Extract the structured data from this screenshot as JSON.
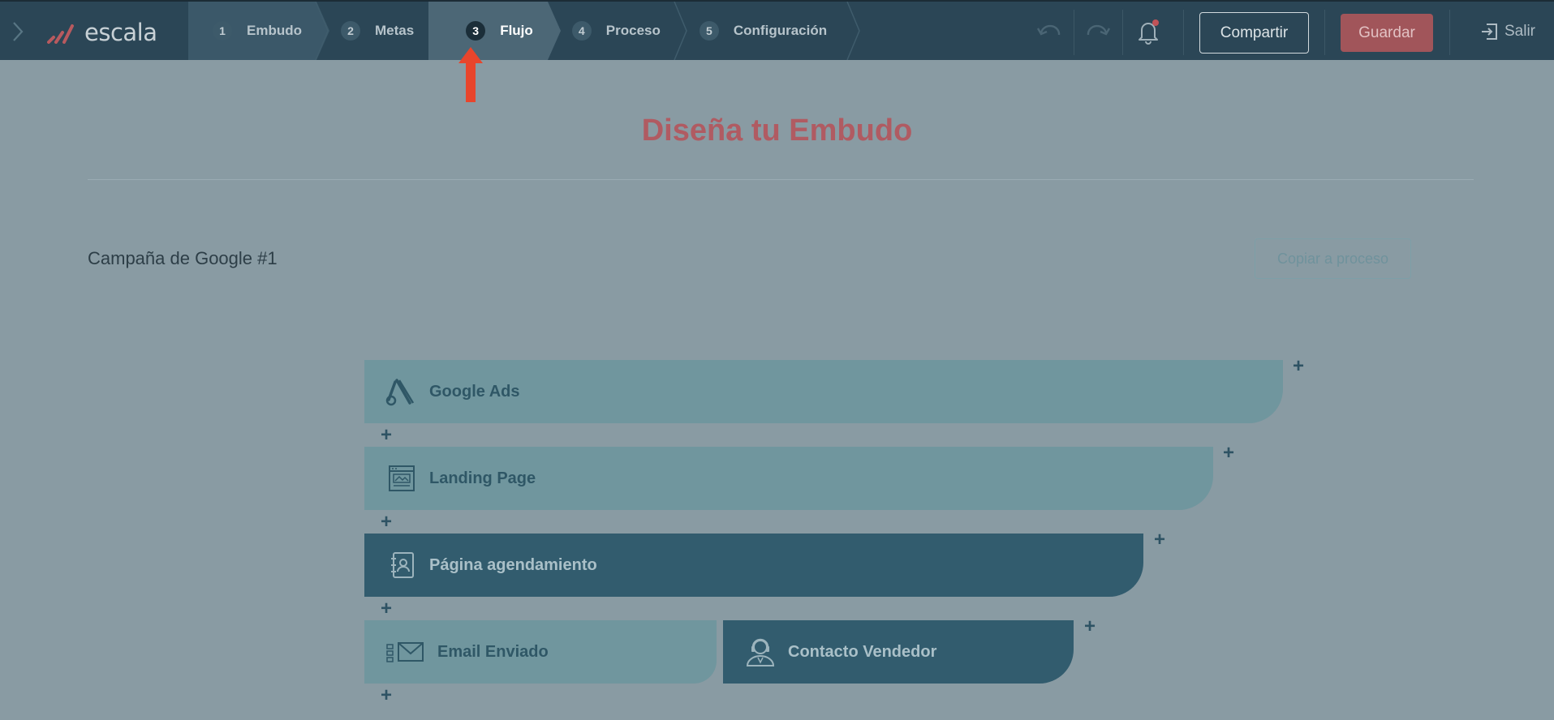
{
  "app": {
    "logo_text": "escala"
  },
  "nav": {
    "steps": [
      {
        "num": "1",
        "label": "Embudo"
      },
      {
        "num": "2",
        "label": "Metas"
      },
      {
        "num": "3",
        "label": "Flujo"
      },
      {
        "num": "4",
        "label": "Proceso"
      },
      {
        "num": "5",
        "label": "Configuración"
      }
    ],
    "active_step": "3"
  },
  "toolbar": {
    "share_label": "Compartir",
    "save_label": "Guardar",
    "exit_label": "Salir"
  },
  "icons": {
    "menu": "chevron-right-icon",
    "undo": "undo-icon",
    "redo": "redo-icon",
    "notifications": "bell-icon",
    "exit": "exit-icon",
    "pointer": "arrow-up-icon"
  },
  "main": {
    "title": "Diseña tu Embudo",
    "campaign_name": "Campaña de Google #1",
    "copy_button": "Copiar a proceso"
  },
  "funnel": {
    "stages": [
      {
        "label": "Google Ads",
        "icon": "google-ads-icon",
        "style": "light"
      },
      {
        "label": "Landing Page",
        "icon": "landing-page-icon",
        "style": "light"
      },
      {
        "label": "Página agendamiento",
        "icon": "scheduling-book-icon",
        "style": "dark"
      },
      {
        "label": "Email Enviado",
        "icon": "email-icon",
        "style": "light"
      },
      {
        "label": "Contacto Vendedor",
        "icon": "salesperson-icon",
        "style": "dark"
      }
    ],
    "add_symbol": "+"
  },
  "colors": {
    "topbar": "#2b4656",
    "background": "#899ba3",
    "title": "#b05b62",
    "save_button": "#a1555a",
    "stage_light": "#70969e",
    "stage_dark": "#325c6e",
    "pointer": "#e8452c"
  }
}
